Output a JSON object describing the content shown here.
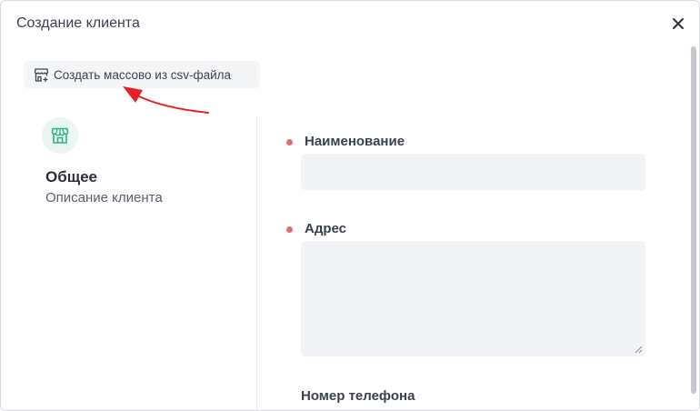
{
  "modal": {
    "title": "Создание клиента",
    "close_label": "×"
  },
  "toolbar": {
    "bulk_create_label": "Создать массово из csv-файла",
    "bulk_create_icon": "store-add-icon"
  },
  "annotation": {
    "arrow_color": "#e8202a"
  },
  "section": {
    "icon": "store-icon",
    "title": "Общее",
    "description": "Описание клиента"
  },
  "form": {
    "fields": [
      {
        "label": "Наименование",
        "required": true,
        "value": "",
        "type": "text"
      },
      {
        "label": "Адрес",
        "required": true,
        "value": "",
        "type": "textarea"
      },
      {
        "label": "Номер телефона",
        "required": false,
        "value": "",
        "type": "text"
      }
    ]
  },
  "colors": {
    "required_dot": "#e26d6d",
    "input_bg": "#f1f3f7",
    "icon_accent": "#2bb38a"
  }
}
